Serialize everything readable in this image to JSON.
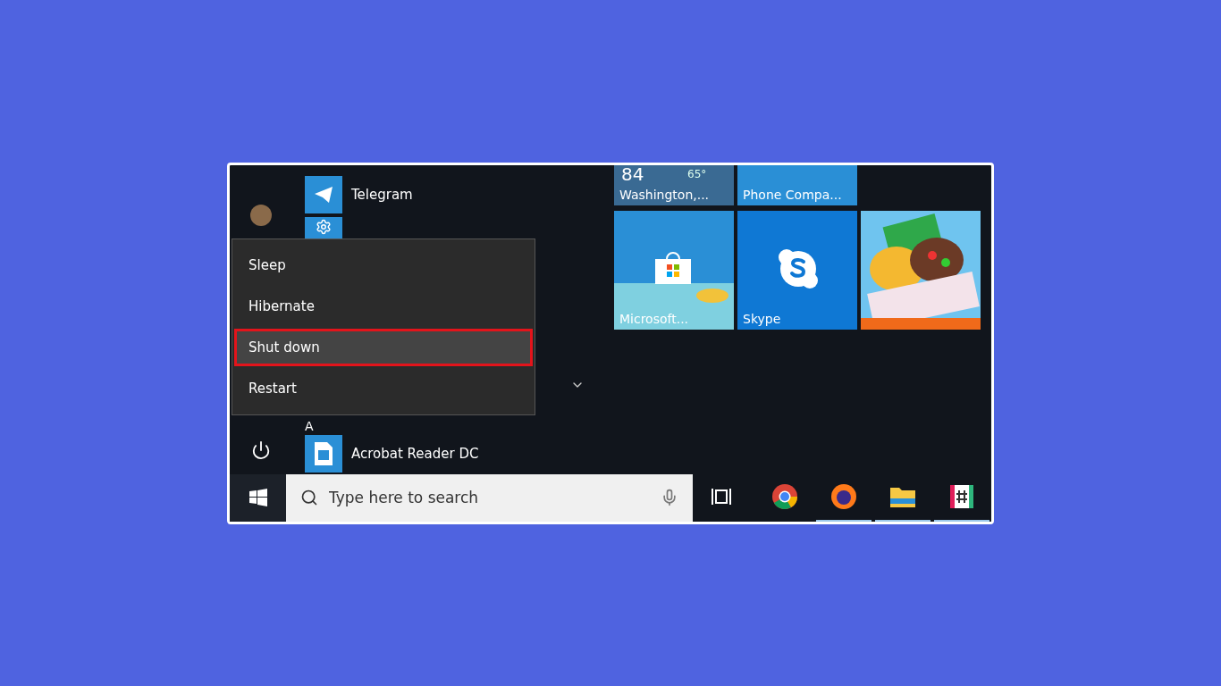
{
  "start_menu": {
    "apps_top": [
      {
        "kind": "telegram",
        "label": "Telegram"
      },
      {
        "kind": "settings"
      }
    ],
    "section_letter": "A",
    "apps_bottom": [
      {
        "kind": "acrobat",
        "label": "Acrobat Reader DC"
      }
    ]
  },
  "power_menu": {
    "items": [
      {
        "label": "Sleep",
        "selected": false
      },
      {
        "label": "Hibernate",
        "selected": false
      },
      {
        "label": "Shut down",
        "selected": true
      },
      {
        "label": "Restart",
        "selected": false
      }
    ]
  },
  "tile_rows": [
    [
      {
        "kind": "weather",
        "temperature": "84",
        "low": "65°",
        "label": "Washington,..."
      },
      {
        "kind": "phone",
        "label": "Phone Compa..."
      }
    ],
    [
      {
        "kind": "store",
        "label": "Microsoft..."
      },
      {
        "kind": "skype",
        "label": "Skype"
      },
      {
        "kind": "game"
      }
    ]
  ],
  "taskbar": {
    "search": {
      "placeholder": "Type here to search"
    },
    "apps": [
      {
        "kind": "chrome",
        "running": false
      },
      {
        "kind": "firefox",
        "running": true
      },
      {
        "kind": "explorer",
        "running": true
      },
      {
        "kind": "slack",
        "running": true
      }
    ]
  }
}
